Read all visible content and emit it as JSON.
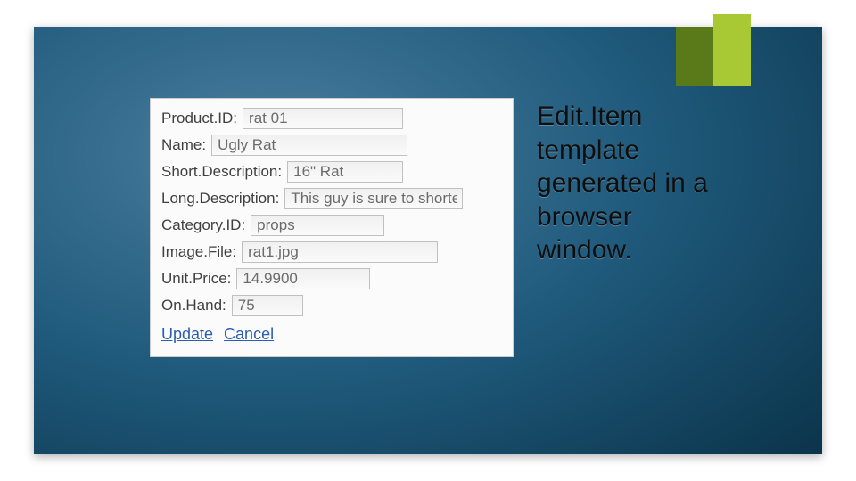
{
  "caption": "Edit.Item template generated in a browser window.",
  "form": {
    "fields": [
      {
        "label": "Product.ID:",
        "value": "rat 01"
      },
      {
        "label": "Name:",
        "value": "Ugly Rat"
      },
      {
        "label": "Short.Description:",
        "value": "16\" Rat"
      },
      {
        "label": "Long.Description:",
        "value": "This guy is sure to shorte"
      },
      {
        "label": "Category.ID:",
        "value": "props"
      },
      {
        "label": "Image.File:",
        "value": "rat1.jpg"
      },
      {
        "label": "Unit.Price:",
        "value": "14.9900"
      },
      {
        "label": "On.Hand:",
        "value": "75"
      }
    ],
    "actions": {
      "update": "Update",
      "cancel": "Cancel"
    }
  }
}
